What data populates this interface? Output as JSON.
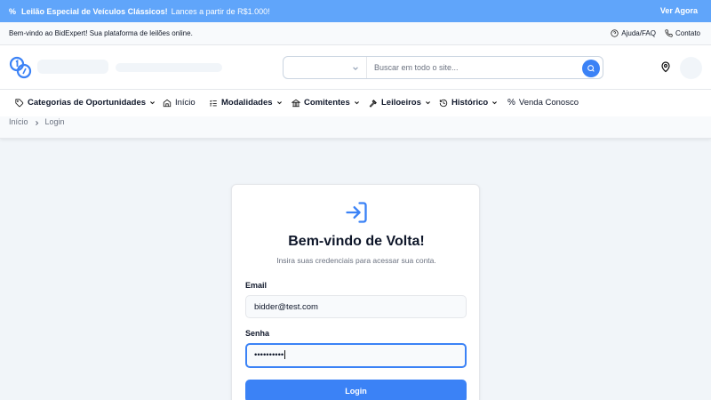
{
  "promo": {
    "bold_text": "Leilão Especial de Veículos Clássicos!",
    "text": "Lances a partir de R$1.000!",
    "cta": "Ver Agora"
  },
  "topbar": {
    "welcome": "Bem-vindo ao BidExpert! Sua plataforma de leilões online.",
    "help": "Ajuda/FAQ",
    "contact": "Contato"
  },
  "header": {
    "search_placeholder": "Buscar em todo o site..."
  },
  "nav": {
    "categories": "Categorias de Oportunidades",
    "home": "Início",
    "modalities": "Modalidades",
    "consignors": "Comitentes",
    "auctioneers": "Leiloeiros",
    "history": "Histórico",
    "sell": "Venda Conosco"
  },
  "breadcrumb": {
    "home": "Início",
    "current": "Login"
  },
  "login": {
    "title": "Bem-vindo de Volta!",
    "subtitle": "Insira suas credenciais para acessar sua conta.",
    "email_label": "Email",
    "email_value": "bidder@test.com",
    "password_label": "Senha",
    "password_value": "••••••••••",
    "submit": "Login"
  },
  "colors": {
    "accent": "#3b82f6",
    "promo_bg": "#60a5fa"
  }
}
